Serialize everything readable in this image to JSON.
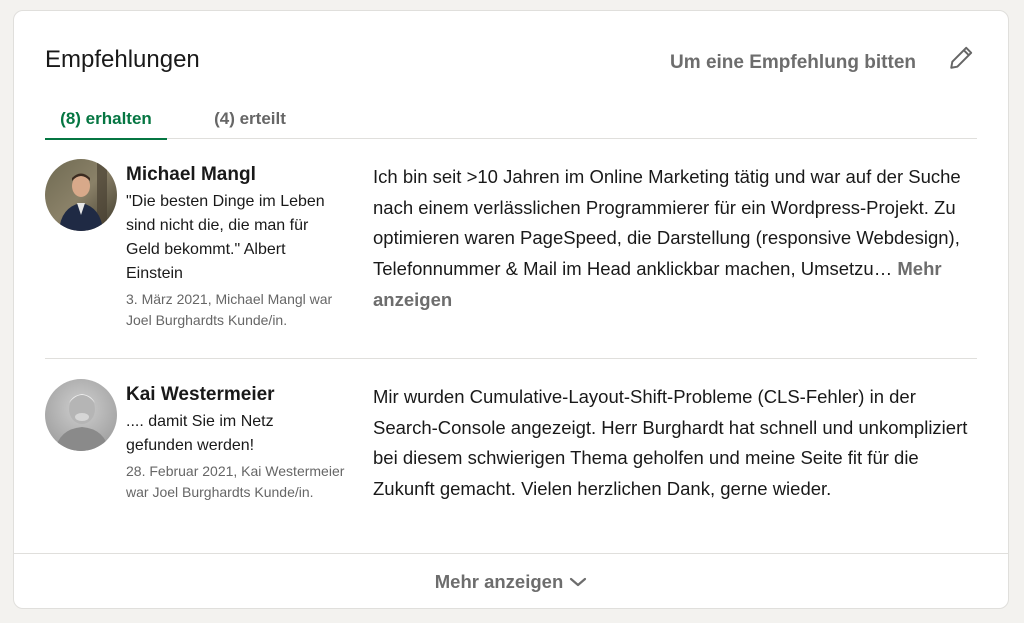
{
  "section": {
    "title": "Empfehlungen",
    "request_label": "Um eine Empfehlung bitten",
    "edit_icon": "pencil-icon"
  },
  "tabs": [
    {
      "label": "(8) erhalten",
      "active": true
    },
    {
      "label": "(4) erteilt",
      "active": false
    }
  ],
  "recommendations": [
    {
      "name": "Michael Mangl",
      "headline": "\"Die besten Dinge im Leben sind nicht die, die man für Geld bekommt.\" Albert Einstein",
      "meta": "3. März 2021, Michael Mangl war Joel Burghardts Kunde/in.",
      "text": "Ich bin seit >10 Jahren im Online Marketing tätig und war auf der Suche nach einem verlässlichen Programmierer für ein Wordpress-Projekt. Zu optimieren waren PageSpeed, die Darstellung (responsive Webdesign), Telefonnummer & Mail im Head anklickbar machen, Umsetzu…",
      "more_label": "Mehr anzeigen"
    },
    {
      "name": "Kai Westermeier",
      "headline": ".... damit Sie im Netz gefunden werden!",
      "meta": "28. Februar 2021, Kai Westermeier war Joel Burghardts Kunde/in.",
      "text": "Mir wurden Cumulative-Layout-Shift-Probleme (CLS-Fehler) in der Search-Console angezeigt. Herr Burghardt hat schnell und unkompliziert bei diesem schwierigen Thema geholfen und meine Seite fit für die Zukunft gemacht. Vielen herzlichen Dank, gerne wieder."
    }
  ],
  "footer": {
    "more_label": "Mehr anzeigen",
    "icon": "chevron-down-icon"
  },
  "colors": {
    "accent": "#057642",
    "muted": "#666666",
    "divider": "#e0dfdc"
  }
}
